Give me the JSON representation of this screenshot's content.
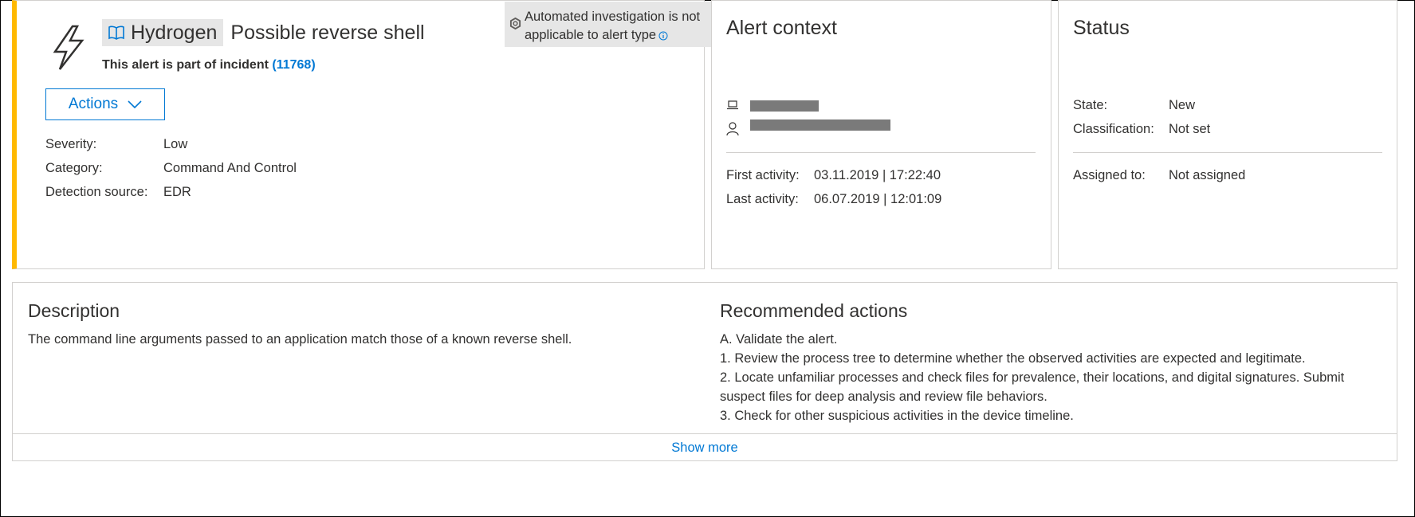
{
  "alert": {
    "tenant": "Hydrogen",
    "title": "Possible reverse shell",
    "incident_prefix": "This alert is part of incident",
    "incident_id": "(11768)",
    "actions_label": "Actions",
    "severity_label": "Severity:",
    "severity_value": "Low",
    "category_label": "Category:",
    "category_value": "Command And Control",
    "detection_label": "Detection source:",
    "detection_value": "EDR",
    "auto_line1": "Automated investigation is not",
    "auto_line2": "applicable to alert type"
  },
  "context": {
    "heading": "Alert context",
    "first_label": "First activity:",
    "first_value": "03.11.2019 | 17:22:40",
    "last_label": "Last activity:",
    "last_value": "06.07.2019 | 12:01:09"
  },
  "status": {
    "heading": "Status",
    "state_label": "State:",
    "state_value": "New",
    "class_label": "Classification:",
    "class_value": "Not set",
    "assigned_label": "Assigned to:",
    "assigned_value": "Not assigned"
  },
  "description": {
    "heading": "Description",
    "text": "The command line arguments passed to an application match those of a known reverse shell."
  },
  "recommended": {
    "heading": "Recommended actions",
    "line_a": "A. Validate the alert.",
    "line_1": "1. Review the process tree to determine whether the observed activities are expected and legitimate.",
    "line_2a": "2. Locate unfamiliar processes and check files for prevalence, their locations, and digital signatures. Submit",
    "line_2b": "suspect files for deep analysis and review file behaviors.",
    "line_3": "3. Check for other suspicious activities in the device timeline."
  },
  "show_more": "Show more",
  "colors": {
    "accent": "#0078d4",
    "severity_bar": "#ffb900",
    "redacted": "#7a7a7a"
  }
}
